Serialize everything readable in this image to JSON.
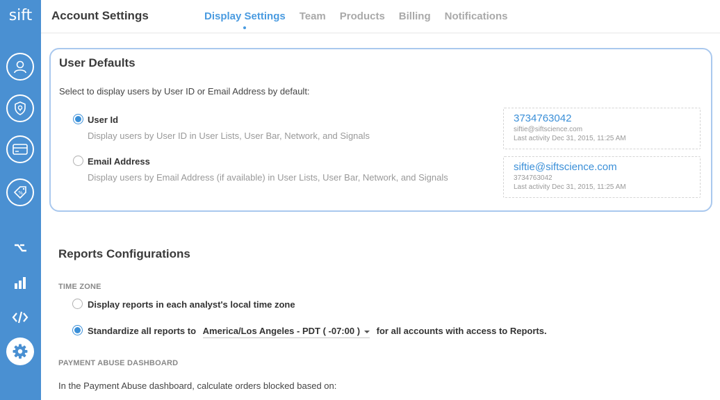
{
  "sidebar": {
    "logo": "sift",
    "icons": [
      "user-icon",
      "shield-lightbulb-icon",
      "credit-card-icon",
      "promo-tag-icon",
      "workflow-icon",
      "bar-chart-icon",
      "code-icon",
      "gear-icon"
    ],
    "accent": "#4a90d2"
  },
  "header": {
    "title": "Account Settings",
    "tabs": [
      {
        "label": "Display Settings",
        "active": true
      },
      {
        "label": "Team",
        "active": false
      },
      {
        "label": "Products",
        "active": false
      },
      {
        "label": "Billing",
        "active": false
      },
      {
        "label": "Notifications",
        "active": false
      }
    ]
  },
  "user_defaults": {
    "title": "User Defaults",
    "description": "Select to display users by User ID or Email Address by default:",
    "options": [
      {
        "label": "User Id",
        "sub": "Display users by User ID in User Lists, User Bar, Network, and Signals",
        "checked": true,
        "preview": {
          "main": "3734763042",
          "sub": "siftie@siftscience.com",
          "last": "Last activity Dec 31, 2015, 11:25 AM"
        }
      },
      {
        "label": "Email Address",
        "sub": "Display users by Email Address (if available) in User Lists, User Bar, Network, and Signals",
        "checked": false,
        "preview": {
          "main": "siftie@siftscience.com",
          "sub": "3734763042",
          "last": "Last activity Dec 31, 2015, 11:25 AM"
        }
      }
    ]
  },
  "reports": {
    "title": "Reports Configurations",
    "time_zone_heading": "TIME ZONE",
    "tz_option_local": "Display reports in each analyst's local time zone",
    "tz_option_standard_prefix": "Standardize all reports to",
    "tz_selected": "America/Los Angeles - PDT ( -07:00 )",
    "tz_option_standard_suffix": "for all accounts with access to Reports.",
    "payment_heading": "PAYMENT ABUSE DASHBOARD",
    "payment_text": "In the Payment Abuse dashboard, calculate orders blocked based on:"
  }
}
